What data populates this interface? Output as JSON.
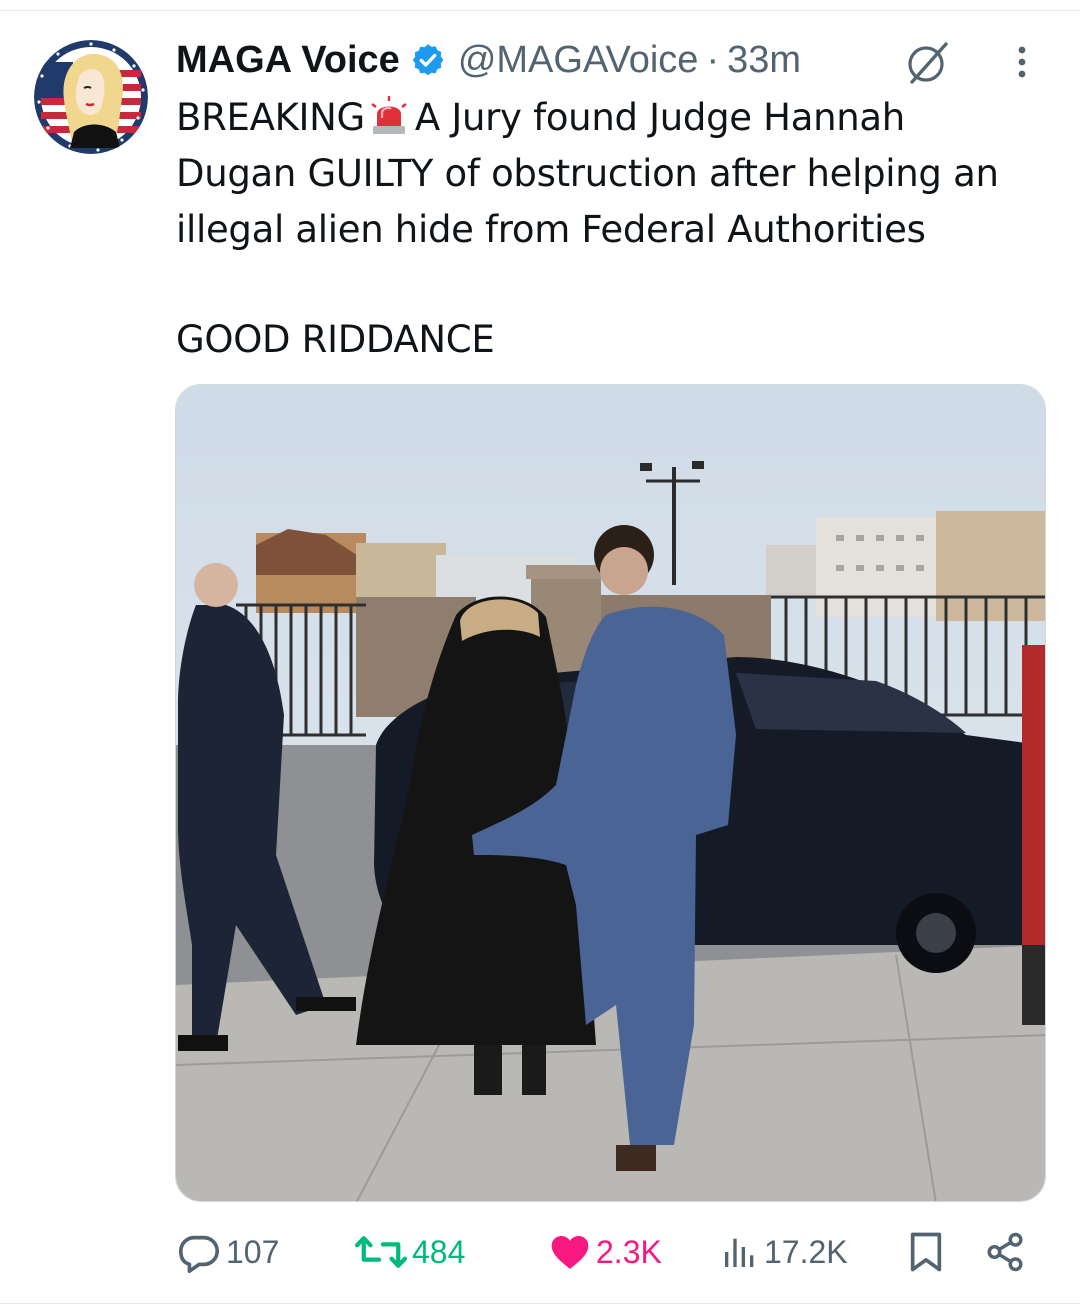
{
  "post": {
    "display_name": "MAGA Voice",
    "handle": "@MAGAVoice",
    "separator": "·",
    "time": "33m",
    "text_lines": [
      "BREAKING",
      "A Jury found Judge Hannah",
      "Dugan GUILTY of obstruction after helping an",
      "illegal alien hide from Federal Authorities"
    ],
    "text_second_paragraph": "GOOD RIDDANCE"
  },
  "stats": {
    "replies": "107",
    "reposts": "484",
    "likes": "2.3K",
    "views": "17.2K"
  },
  "icons": {
    "verified": "verified-badge-icon",
    "siren": "siren-emoji-icon",
    "grok": "grok-icon",
    "more": "more-vertical-icon",
    "reply": "reply-icon",
    "repost": "repost-icon",
    "like": "heart-icon",
    "views": "views-icon",
    "bookmark": "bookmark-icon",
    "share": "share-icon"
  },
  "colors": {
    "text": "#0f1419",
    "secondary": "#536471",
    "verified": "#1d9bf0",
    "repost_active": "#00ba7c",
    "like_active": "#f91880"
  }
}
